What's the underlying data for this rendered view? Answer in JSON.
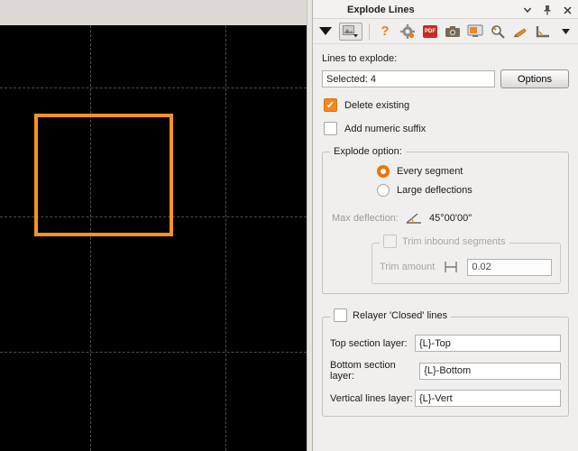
{
  "panel": {
    "title": "Explode Lines",
    "toolbar": {
      "help": "?",
      "pdf": "PDF"
    },
    "lines_to_explode_label": "Lines to explode:",
    "selected_input": "Selected: 4",
    "options_button": "Options",
    "delete_existing_label": "Delete existing",
    "add_numeric_suffix_label": "Add numeric suffix",
    "explode_option": {
      "legend": "Explode option:",
      "radio_every_segment": "Every segment",
      "radio_large_deflections": "Large deflections",
      "max_deflection_label": "Max deflection:",
      "max_deflection_value": "45°00'00\"",
      "trim": {
        "legend": "Trim inbound segments",
        "amount_label": "Trim amount",
        "amount_value": "0.02"
      }
    },
    "relayer": {
      "legend": "Relayer 'Closed' lines",
      "fields": [
        {
          "label": "Top section layer:",
          "value": "{L}-Top"
        },
        {
          "label": "Bottom section layer:",
          "value": "{L}-Bottom"
        },
        {
          "label": "Vertical lines layer:",
          "value": "{L}-Vert"
        }
      ]
    }
  },
  "canvas": {
    "selection_shape": "rectangle",
    "selection_stroke": "#f7941d"
  },
  "colors": {
    "accent_orange": "#ef7d18",
    "canvas_background": "#000000",
    "panel_background": "#f0efed"
  }
}
